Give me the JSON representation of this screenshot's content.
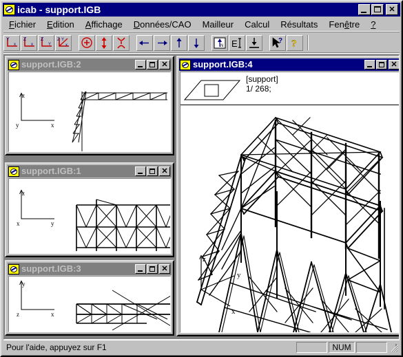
{
  "window": {
    "title": "icab - support.IGB",
    "app_icon": "compass-icon",
    "controls": [
      {
        "name": "minimize",
        "glyph": "_"
      },
      {
        "name": "maximize",
        "glyph": "□"
      },
      {
        "name": "close",
        "glyph": "✕"
      }
    ]
  },
  "menu": {
    "items": [
      {
        "label": "Fichier",
        "accel": "F"
      },
      {
        "label": "Edition",
        "accel": "E"
      },
      {
        "label": "Affichage",
        "accel": "A"
      },
      {
        "label": "Données/CAO",
        "accel": "D"
      },
      {
        "label": "Mailleur",
        "accel": ""
      },
      {
        "label": "Calcul",
        "accel": ""
      },
      {
        "label": "Résultats",
        "accel": ""
      },
      {
        "label": "Fenêtre",
        "accel": "ê"
      },
      {
        "label": "?",
        "accel": "?"
      }
    ]
  },
  "toolbar": {
    "groups": [
      {
        "name": "view-planes",
        "buttons": [
          {
            "name": "view-yx-icon",
            "tip": "Vue plan Y-X"
          },
          {
            "name": "view-zx-icon",
            "tip": "Vue plan Z-X"
          },
          {
            "name": "view-zy-icon",
            "tip": "Vue plan Z-Y"
          },
          {
            "name": "view-3d-icon",
            "tip": "Vue 3D ZY-X"
          }
        ]
      },
      {
        "name": "transform",
        "buttons": [
          {
            "name": "zoom-target-icon",
            "tip": "Zoom centré"
          },
          {
            "name": "scale-vertical-icon",
            "tip": "Echelle verticale"
          },
          {
            "name": "scale-horizontal-icon",
            "tip": "Echelle horizontale"
          }
        ]
      },
      {
        "name": "pan",
        "buttons": [
          {
            "name": "pan-left-icon",
            "tip": "Déplacer à gauche"
          },
          {
            "name": "pan-right-icon",
            "tip": "Déplacer à droite"
          },
          {
            "name": "pan-up-icon",
            "tip": "Déplacer vers le haut"
          },
          {
            "name": "pan-down-icon",
            "tip": "Déplacer vers le bas"
          }
        ]
      },
      {
        "name": "elements",
        "buttons": [
          {
            "name": "node-icon",
            "tip": "Noeuds"
          },
          {
            "name": "element-icon",
            "tip": "Eléments"
          },
          {
            "name": "support-icon",
            "tip": "Appuis"
          }
        ]
      },
      {
        "name": "help",
        "buttons": [
          {
            "name": "context-help-icon",
            "tip": "Aide contextuelle"
          },
          {
            "name": "help-icon",
            "tip": "Aide"
          }
        ]
      }
    ]
  },
  "children": [
    {
      "id": "igb2",
      "title": "support.IGB:2",
      "state": "inactive",
      "axes": {
        "up": "z",
        "left": "y",
        "right": "x"
      }
    },
    {
      "id": "igb1",
      "title": "support.IGB:1",
      "state": "inactive",
      "axes": {
        "up": "z",
        "left": "x",
        "right": "y"
      }
    },
    {
      "id": "igb3",
      "title": "support.IGB:3",
      "state": "inactive",
      "axes": {
        "up": "y",
        "left": "z",
        "right": "x"
      }
    },
    {
      "id": "igb4",
      "title": "support.IGB:4",
      "state": "active",
      "header": {
        "label": "[support]",
        "count": "1/ 268;",
        "icon": "parallelogram-selection-icon"
      },
      "axes": {
        "up": "z",
        "right_upper": "y",
        "right_lower": "x"
      }
    }
  ],
  "statusbar": {
    "hint": "Pour l'aide, appuyez sur F1",
    "panes": [
      "",
      "NUM",
      ""
    ]
  },
  "colors": {
    "titlebar_active": "#000080",
    "titlebar_inactive": "#808080",
    "face": "#c0c0c0",
    "accent_red": "#d00000",
    "accent_blue": "#000080",
    "icon_yellow": "#ffff00",
    "canvas": "#ffffff",
    "mdi_background": "#808080"
  }
}
